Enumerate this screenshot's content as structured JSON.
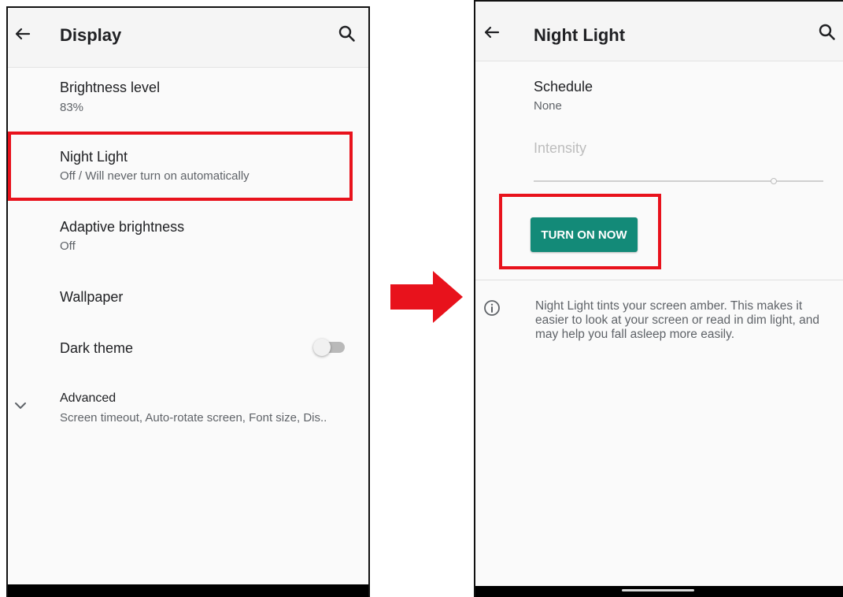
{
  "display_screen": {
    "title": "Display",
    "items": [
      {
        "title": "Brightness level",
        "subtitle": "83%"
      },
      {
        "title": "Night Light",
        "subtitle": "Off / Will never turn on automatically"
      },
      {
        "title": "Adaptive brightness",
        "subtitle": "Off"
      },
      {
        "title": "Wallpaper"
      },
      {
        "title": "Dark theme",
        "toggle_on": false
      },
      {
        "title": "Advanced",
        "subtitle": "Screen timeout, Auto-rotate screen, Font size, Dis.."
      }
    ]
  },
  "night_light_screen": {
    "title": "Night Light",
    "schedule": {
      "title": "Schedule",
      "value": "None"
    },
    "intensity": {
      "label": "Intensity",
      "level_fraction": 0.83
    },
    "turn_on_button": "TURN ON NOW",
    "info_text": "Night Light tints your screen amber. This makes it easier to look at your screen or read in dim light, and may help you fall asleep more easily."
  },
  "icons": [
    "back-arrow-icon",
    "search-icon",
    "chevron-down-icon",
    "info-icon",
    "arrow-right-icon"
  ],
  "colors": {
    "highlight": "#e8121c",
    "button": "#138a78",
    "arrow": "#e8121c"
  }
}
